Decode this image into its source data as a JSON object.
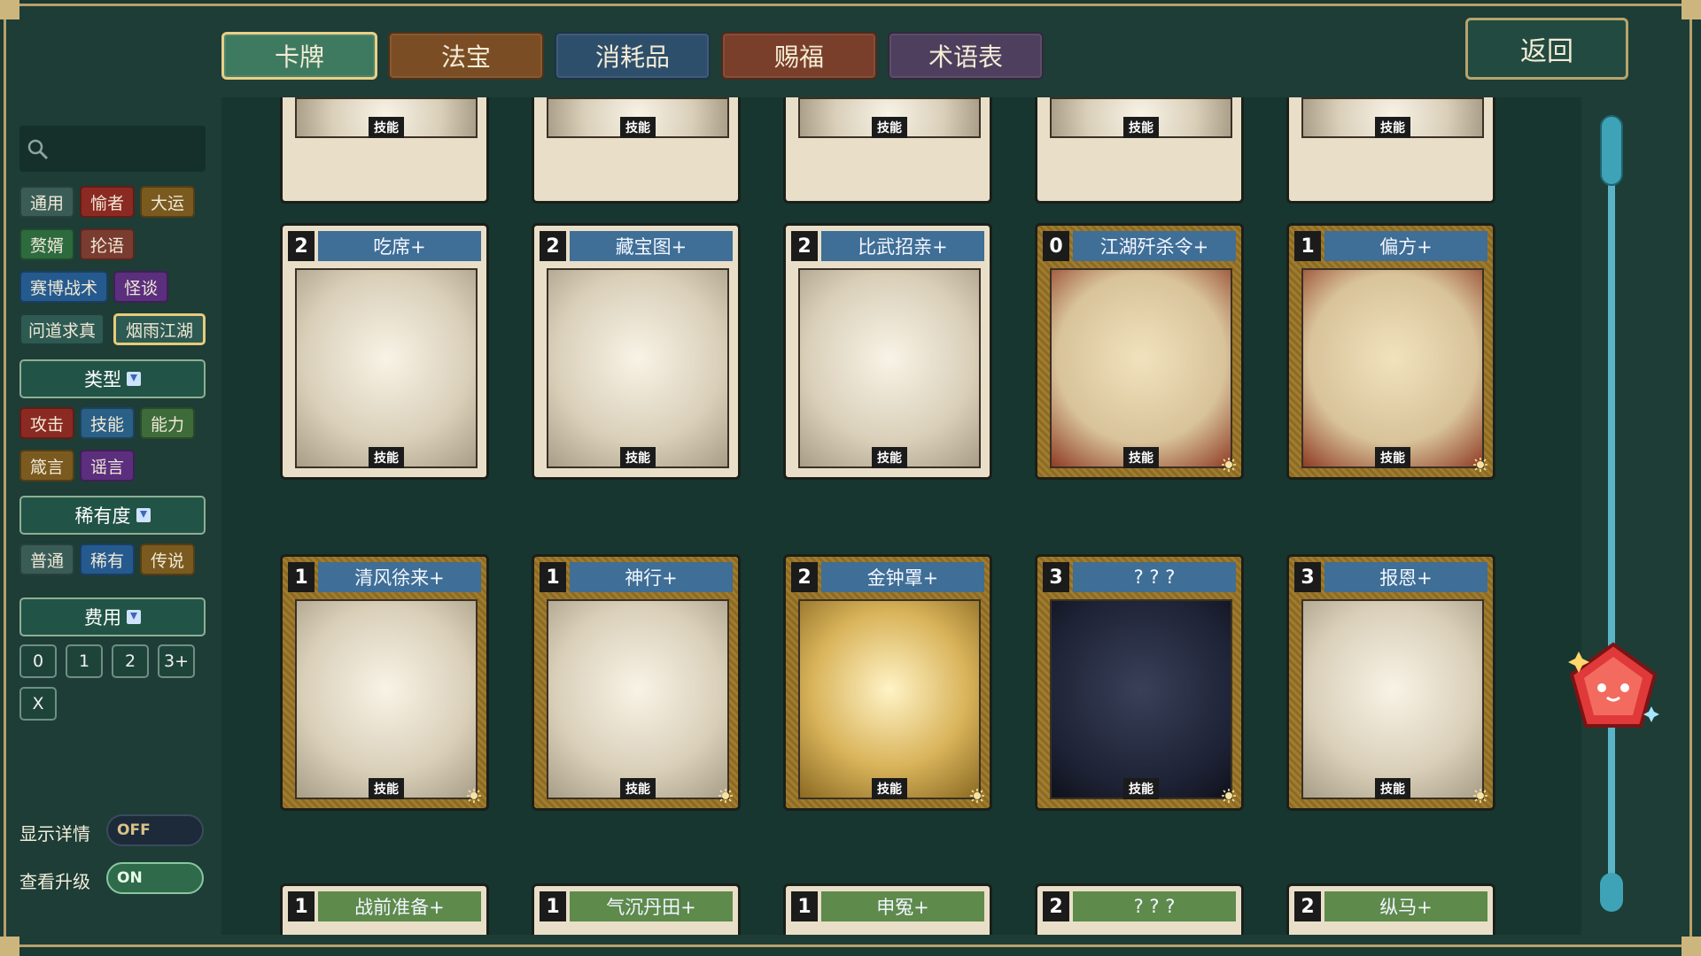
{
  "tabs": [
    {
      "label": "卡牌",
      "color": "#3e7a60",
      "active": true
    },
    {
      "label": "法宝",
      "color": "#7b4d24",
      "active": false
    },
    {
      "label": "消耗品",
      "color": "#2e4f6c",
      "active": false
    },
    {
      "label": "赐福",
      "color": "#7a3f2a",
      "active": false
    },
    {
      "label": "术语表",
      "color": "#4d3f5d",
      "active": false
    }
  ],
  "back_label": "返回",
  "search": {
    "placeholder": ""
  },
  "class_filters": [
    {
      "label": "通用",
      "color": "#3a5c57"
    },
    {
      "label": "愉者",
      "color": "#8b2a22"
    },
    {
      "label": "大运",
      "color": "#7a5a1f"
    },
    {
      "label": "赘婿",
      "color": "#2d6b3f"
    },
    {
      "label": "抡语",
      "color": "#7a3c30"
    },
    {
      "label": "赛博战术",
      "color": "#255a8e"
    },
    {
      "label": "怪谈",
      "color": "#5b2f7d"
    },
    {
      "label": "问道求真",
      "color": "#2d5a52"
    },
    {
      "label": "烟雨江湖",
      "color": "#2d5a52"
    }
  ],
  "type_section": {
    "label": "类型"
  },
  "type_filters": [
    {
      "label": "攻击",
      "color": "#8b2a22"
    },
    {
      "label": "技能",
      "color": "#2a5f86"
    },
    {
      "label": "能力",
      "color": "#3d6b3a"
    },
    {
      "label": "箴言",
      "color": "#7a5a1f"
    },
    {
      "label": "谣言",
      "color": "#5b2f7d"
    }
  ],
  "rarity_section": {
    "label": "稀有度"
  },
  "rarity_filters": [
    {
      "label": "普通",
      "color": "#3a5c57"
    },
    {
      "label": "稀有",
      "color": "#255a8e"
    },
    {
      "label": "传说",
      "color": "#7a5a1f"
    }
  ],
  "cost_section": {
    "label": "费用"
  },
  "cost_filters": [
    "0",
    "1",
    "2",
    "3+",
    "X"
  ],
  "show_details": {
    "label": "显示详情",
    "value": "OFF"
  },
  "view_upgrade": {
    "label": "查看升级",
    "value": "ON"
  },
  "skill_tag": "技能",
  "row_top_skill": [
    "技能",
    "技能",
    "技能",
    "技能",
    "技能"
  ],
  "row1": [
    {
      "cost": "2",
      "name": "吃席+",
      "frame": "parch",
      "banner": "blue",
      "art": "feast"
    },
    {
      "cost": "2",
      "name": "藏宝图+",
      "frame": "parch",
      "banner": "blue",
      "art": "map"
    },
    {
      "cost": "2",
      "name": "比武招亲+",
      "frame": "parch",
      "banner": "blue",
      "art": "arena"
    },
    {
      "cost": "0",
      "name": "江湖歼杀令+",
      "frame": "gold",
      "banner": "blue",
      "art": "wanted"
    },
    {
      "cost": "1",
      "name": "偏方+",
      "frame": "gold",
      "banner": "blue",
      "art": "pot"
    }
  ],
  "row2": [
    {
      "cost": "1",
      "name": "清风徐来+",
      "frame": "gold",
      "banner": "blue",
      "art": "fan"
    },
    {
      "cost": "1",
      "name": "神行+",
      "frame": "gold",
      "banner": "blue",
      "art": "runner"
    },
    {
      "cost": "2",
      "name": "金钟罩+",
      "frame": "gold",
      "banner": "blue",
      "art": "bell"
    },
    {
      "cost": "3",
      "name": "? ? ?",
      "frame": "gold",
      "banner": "blue",
      "art": "night"
    },
    {
      "cost": "3",
      "name": "报恩+",
      "frame": "gold",
      "banner": "blue",
      "art": "embrace"
    }
  ],
  "row3": [
    {
      "cost": "1",
      "name": "战前准备+",
      "banner": "green"
    },
    {
      "cost": "1",
      "name": "气沉丹田+",
      "banner": "green"
    },
    {
      "cost": "1",
      "name": "申冤+",
      "banner": "green"
    },
    {
      "cost": "2",
      "name": "? ? ?",
      "banner": "green"
    },
    {
      "cost": "2",
      "name": "纵马+",
      "banner": "green"
    }
  ]
}
